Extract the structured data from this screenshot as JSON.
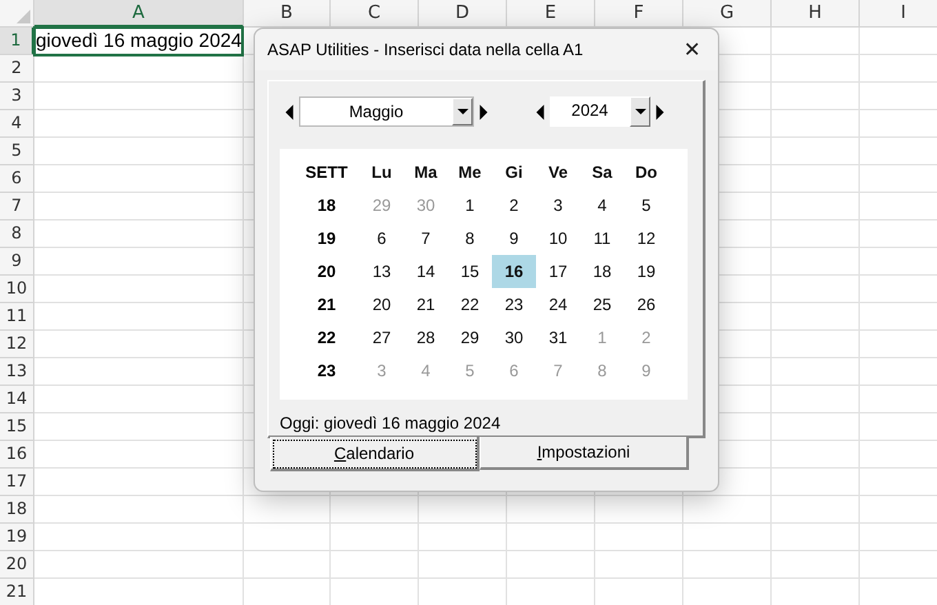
{
  "sheet": {
    "columns": [
      {
        "label": "A",
        "selected": true
      },
      {
        "label": "B",
        "selected": false
      },
      {
        "label": "C",
        "selected": false
      },
      {
        "label": "D",
        "selected": false
      },
      {
        "label": "E",
        "selected": false
      },
      {
        "label": "F",
        "selected": false
      },
      {
        "label": "G",
        "selected": false
      },
      {
        "label": "H",
        "selected": false
      },
      {
        "label": "I",
        "selected": false
      }
    ],
    "rows": [
      {
        "label": "1",
        "selected": true
      },
      {
        "label": "2",
        "selected": false
      },
      {
        "label": "3",
        "selected": false
      },
      {
        "label": "4",
        "selected": false
      },
      {
        "label": "5",
        "selected": false
      },
      {
        "label": "6",
        "selected": false
      },
      {
        "label": "7",
        "selected": false
      },
      {
        "label": "8",
        "selected": false
      },
      {
        "label": "9",
        "selected": false
      },
      {
        "label": "10",
        "selected": false
      },
      {
        "label": "11",
        "selected": false
      },
      {
        "label": "12",
        "selected": false
      },
      {
        "label": "13",
        "selected": false
      },
      {
        "label": "14",
        "selected": false
      },
      {
        "label": "15",
        "selected": false
      },
      {
        "label": "16",
        "selected": false
      },
      {
        "label": "17",
        "selected": false
      },
      {
        "label": "18",
        "selected": false
      },
      {
        "label": "19",
        "selected": false
      },
      {
        "label": "20",
        "selected": false
      },
      {
        "label": "21",
        "selected": false
      }
    ],
    "active_cell_value": "giovedì 16 maggio 2024"
  },
  "dialog": {
    "title": "ASAP Utilities - Inserisci data nella cella A1",
    "close": "✕",
    "month": "Maggio",
    "year": "2024",
    "week_header": "SETT",
    "weekdays": [
      "Lu",
      "Ma",
      "Me",
      "Gi",
      "Ve",
      "Sa",
      "Do"
    ],
    "weeks": [
      {
        "week": "18",
        "days": [
          {
            "d": "29",
            "out": true,
            "selected": false
          },
          {
            "d": "30",
            "out": true,
            "selected": false
          },
          {
            "d": "1",
            "out": false,
            "selected": false
          },
          {
            "d": "2",
            "out": false,
            "selected": false
          },
          {
            "d": "3",
            "out": false,
            "selected": false
          },
          {
            "d": "4",
            "out": false,
            "selected": false
          },
          {
            "d": "5",
            "out": false,
            "selected": false
          }
        ]
      },
      {
        "week": "19",
        "days": [
          {
            "d": "6",
            "out": false,
            "selected": false
          },
          {
            "d": "7",
            "out": false,
            "selected": false
          },
          {
            "d": "8",
            "out": false,
            "selected": false
          },
          {
            "d": "9",
            "out": false,
            "selected": false
          },
          {
            "d": "10",
            "out": false,
            "selected": false
          },
          {
            "d": "11",
            "out": false,
            "selected": false
          },
          {
            "d": "12",
            "out": false,
            "selected": false
          }
        ]
      },
      {
        "week": "20",
        "days": [
          {
            "d": "13",
            "out": false,
            "selected": false
          },
          {
            "d": "14",
            "out": false,
            "selected": false
          },
          {
            "d": "15",
            "out": false,
            "selected": false
          },
          {
            "d": "16",
            "out": false,
            "selected": true
          },
          {
            "d": "17",
            "out": false,
            "selected": false
          },
          {
            "d": "18",
            "out": false,
            "selected": false
          },
          {
            "d": "19",
            "out": false,
            "selected": false
          }
        ]
      },
      {
        "week": "21",
        "days": [
          {
            "d": "20",
            "out": false,
            "selected": false
          },
          {
            "d": "21",
            "out": false,
            "selected": false
          },
          {
            "d": "22",
            "out": false,
            "selected": false
          },
          {
            "d": "23",
            "out": false,
            "selected": false
          },
          {
            "d": "24",
            "out": false,
            "selected": false
          },
          {
            "d": "25",
            "out": false,
            "selected": false
          },
          {
            "d": "26",
            "out": false,
            "selected": false
          }
        ]
      },
      {
        "week": "22",
        "days": [
          {
            "d": "27",
            "out": false,
            "selected": false
          },
          {
            "d": "28",
            "out": false,
            "selected": false
          },
          {
            "d": "29",
            "out": false,
            "selected": false
          },
          {
            "d": "30",
            "out": false,
            "selected": false
          },
          {
            "d": "31",
            "out": false,
            "selected": false
          },
          {
            "d": "1",
            "out": true,
            "selected": false
          },
          {
            "d": "2",
            "out": true,
            "selected": false
          }
        ]
      },
      {
        "week": "23",
        "days": [
          {
            "d": "3",
            "out": true,
            "selected": false
          },
          {
            "d": "4",
            "out": true,
            "selected": false
          },
          {
            "d": "5",
            "out": true,
            "selected": false
          },
          {
            "d": "6",
            "out": true,
            "selected": false
          },
          {
            "d": "7",
            "out": true,
            "selected": false
          },
          {
            "d": "8",
            "out": true,
            "selected": false
          },
          {
            "d": "9",
            "out": true,
            "selected": false
          }
        ]
      }
    ],
    "today": "Oggi: giovedì 16 maggio 2024",
    "tabs": [
      {
        "label": "Calendario",
        "selected": true
      },
      {
        "label": "Impostazioni",
        "selected": false
      }
    ]
  }
}
